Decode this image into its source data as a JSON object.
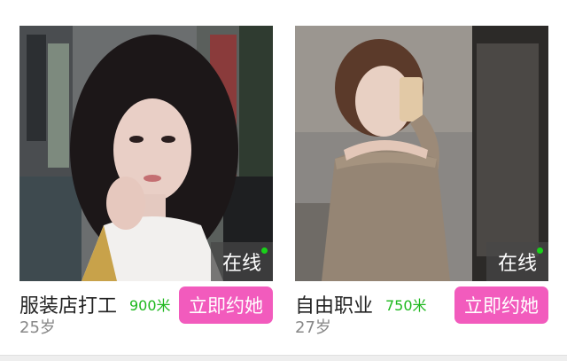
{
  "colors": {
    "accent_pink": "#f25bbd",
    "online_green": "#19d219",
    "distance_green": "#1db81d"
  },
  "cards": [
    {
      "job": "服装店打工",
      "distance": "900米",
      "age": "25岁",
      "online_label": "在线",
      "button_label": "立即约她",
      "photo_icon": "profile-photo"
    },
    {
      "job": "自由职业",
      "distance": "750米",
      "age": "27岁",
      "online_label": "在线",
      "button_label": "立即约她",
      "photo_icon": "profile-photo"
    }
  ]
}
